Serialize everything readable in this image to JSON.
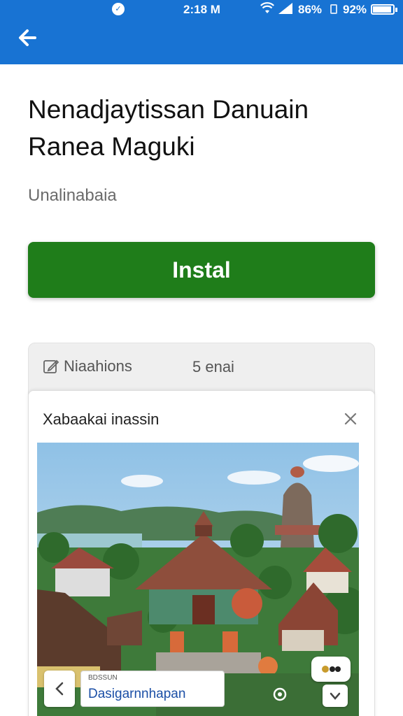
{
  "status_bar": {
    "time": "2:18 M",
    "wifi_percent": "86%",
    "battery_percent": "92%",
    "icons": [
      "notification-icon",
      "wifi-icon",
      "signal-icon",
      "battery-icon"
    ]
  },
  "app_bar": {
    "back_icon": "arrow-left-icon",
    "color": "#1873d3"
  },
  "app": {
    "title_line1": "Nenadjaytissan Danuain",
    "title_line2": "Ranea Maguki",
    "developer": "Unalinabaia",
    "install_label": "Instal",
    "install_color": "#1f7d1a"
  },
  "card": {
    "edit_icon": "edit-icon",
    "label": "Niaahions",
    "count": "5 enai"
  },
  "sheet": {
    "title": "Xabaakai inassin",
    "close_icon": "close-icon"
  },
  "photo_overlay": {
    "prev_icon": "chevron-left-icon",
    "search_small_label": "BDSSUN",
    "search_value": "Dasigarnnhapan",
    "camera_icon": "camera-icon",
    "badge_icon": "dots-icon",
    "down_icon": "chevron-down-icon"
  }
}
